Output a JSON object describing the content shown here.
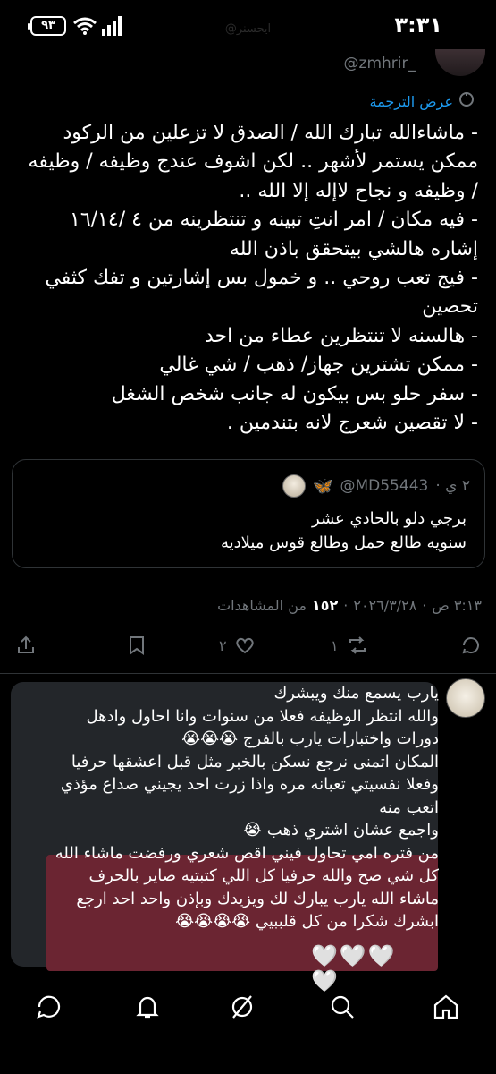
{
  "status_bar": {
    "time": "٣:٣١",
    "battery": "٩٣",
    "faded_handle": "@ايحسنر"
  },
  "header": {
    "handle": "@zmhrir_"
  },
  "translate": {
    "label": "عرض الترجمة",
    "icon": "translate-icon"
  },
  "tweet": {
    "lines": [
      "- ماشاءالله تبارك الله / الصدق لا تزعلين من الركود ممكن يستمر لأشهر .. لكن اشوف عندج وظيفه / وظيفه / وظيفه و نجاح لاإله إلا الله ..",
      "- فيه مكان / امر انتِ تبينه و تنتظرينه من ٤ /١٦/١٤ إشاره هالشي بيتحقق باذن الله",
      "- فيج تعب روحي .. و خمول بس إشارتين و تفك كثفي تحصين",
      "- هالسنه لا تنتظرين عطاء من احد",
      "- ممكن تشترين جهاز/ ذهب / شي غالي",
      "- سفر حلو بس بيكون له جانب شخص الشغل",
      "- لا تقصين شعرج لانه بتندمين ."
    ]
  },
  "quote": {
    "handle": "@MD55443",
    "time": "٢ ي ·",
    "emoji": "🦋",
    "line1": "برجي دلو بالحادي عشر",
    "line2": "سنويه طالع حمل وطالع قوس ميلاديه"
  },
  "meta": {
    "date": "٢٠٢٦/٣/٢٨",
    "time": "٣:١٣ ص",
    "views": "١٥٢",
    "views_label": "من المشاهدات"
  },
  "actions": {
    "reply_count": "",
    "retweet_count": "١",
    "like_count": "٢",
    "bookmark_count": "",
    "share_count": ""
  },
  "dm": {
    "lines": [
      "يارب يسمع منك ويبشرك",
      "والله انتظر الوظيفه فعلا من سنوات وانا احاول وادهل دورات واختبارات يارب بالفرج 😭😭😭",
      "المكان اتمنى نرجع نسكن بالخبر مثل قبل اعشقها حرفيا",
      "وفعلا نفسيتي تعبانه مره واذا زرت احد يجيني صداع مؤذي اتعب منه",
      "واجمع عشان اشتري ذهب 😭",
      "من فتره امي تحاول فيني اقص شعري ورفضت ماشاء الله كل شي صح والله حرفيا كل اللي كتبتيه صاير بالحرف ماشاء الله يارب يبارك لك ويزيدك وبإذن واحد احد ارجع ابشرك شكرا من كل قلببيي 😭😭😭😭"
    ],
    "hearts": "🤍🤍🤍🤍"
  },
  "colors": {
    "accent": "#1d9bf0",
    "muted": "#71767b",
    "bubble": "#23262a",
    "highlight": "#6b2532"
  }
}
